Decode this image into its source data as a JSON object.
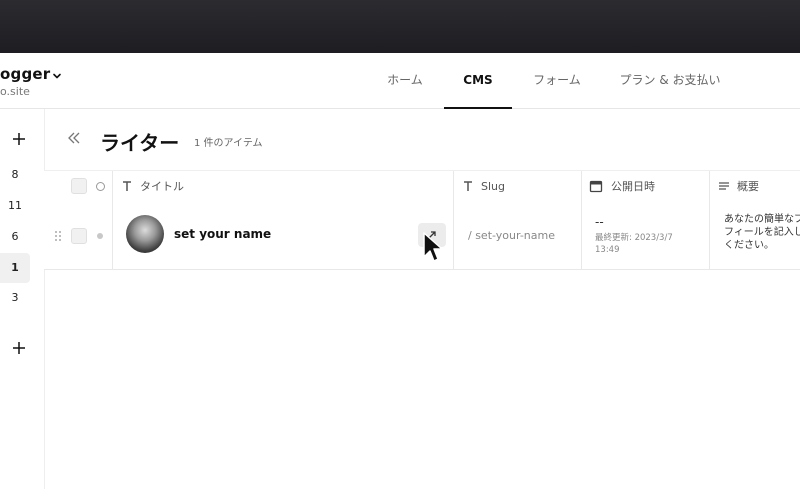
{
  "site": {
    "name": "ogger",
    "domain": "o.site"
  },
  "nav": {
    "tabs": [
      {
        "label": "ホーム",
        "active": false
      },
      {
        "label": "CMS",
        "active": true
      },
      {
        "label": "フォーム",
        "active": false
      },
      {
        "label": "プラン & お支払い",
        "active": false
      }
    ]
  },
  "sidebar": {
    "items": [
      "8",
      "11",
      "6",
      "1",
      "3"
    ],
    "active_item": "1"
  },
  "page": {
    "title": "ライター",
    "item_count": "1 件のアイテム"
  },
  "table": {
    "columns": {
      "title": "タイトル",
      "slug": "Slug",
      "published": "公開日時",
      "summary": "概要"
    },
    "rows": [
      {
        "name": "set your name",
        "slug": "/ set-your-name",
        "published": "--",
        "updated": "最終更新: 2023/3/7 13:49",
        "summary": [
          "あなたの簡単なプ",
          "フィールを記入し",
          "ください。"
        ]
      }
    ]
  },
  "colors": {
    "topbar": "#222227",
    "accent": "#111111",
    "border": "#e8e8e8"
  },
  "icons": [
    "chevron-down-icon",
    "plus-icon",
    "double-chevron-left-icon",
    "text-type-icon",
    "calendar-icon",
    "lines-icon",
    "drag-handle-icon",
    "open-external-icon",
    "mouse-cursor-icon"
  ]
}
